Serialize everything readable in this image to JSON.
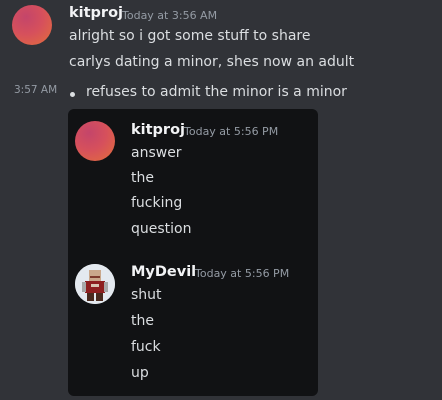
{
  "header_message": {
    "username": "kitproj",
    "timestamp": "Today at 3:56 AM",
    "lines": [
      "alright so i got some stuff to share",
      "carlys dating a minor, shes now an adult"
    ]
  },
  "bullet_message": {
    "timestamp": "3:57 AM",
    "text": "refuses to admit the minor is a minor"
  },
  "forwarded": [
    {
      "username": "kitproj",
      "timestamp": "Today at 5:56 PM",
      "avatar_icon": "gradient-avatar",
      "lines": [
        "answer",
        "the",
        "fucking",
        "question"
      ]
    },
    {
      "username": "MyDevil",
      "timestamp": "Today at 5:56 PM",
      "avatar_icon": "roblox-character-avatar",
      "lines": [
        "shut",
        "the",
        "fuck",
        "up"
      ]
    }
  ],
  "colors": {
    "background": "#313338",
    "embed_background": "#111214",
    "username": "#f2f3f5",
    "message_text": "#dbdee1",
    "timestamp": "#949ba4"
  }
}
